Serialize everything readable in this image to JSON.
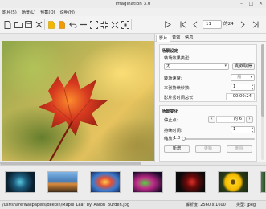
{
  "window": {
    "title": "Imagination 3.0"
  },
  "menubar": {
    "items": [
      "影片(S)",
      "场景(L)",
      "预截(O)",
      "说明(H)"
    ]
  },
  "toolbar": {
    "page_current": "11",
    "page_total": "的24",
    "icons": [
      "new-file-icon",
      "open-folder-icon",
      "save-icon",
      "close-file-icon",
      "import-images-icon",
      "import-audio-icon",
      "undo-icon",
      "remove-icon",
      "zoom-fit-icon",
      "zoom-in-icon",
      "zoom-out-icon",
      "zoom-actual-icon",
      "play-icon",
      "first-slide-icon",
      "prev-slide-icon",
      "next-slide-icon",
      "last-slide-icon"
    ]
  },
  "side_panel": {
    "tabs": [
      "影片",
      "音效",
      "信息"
    ],
    "scene_settings": {
      "header": "场景设定",
      "transition_type_label": "转场效果类型:",
      "transition_type_value": "无",
      "random_button": "乱数取得",
      "transition_speed_label": "转场速度:",
      "transition_speed_value": "一般",
      "duration_label": "本张持续秒数:",
      "duration_value": "1",
      "total_time_label": "影片秀时间总长:",
      "total_time_value": "00:00:24"
    },
    "scene_motion": {
      "header": "场景变化",
      "stop_point_label": "停止点:",
      "stop_point_value": "的 6",
      "duration_label": "持续时间:",
      "duration_value": "1",
      "zoom_label": "缩放:",
      "zoom_value": "1.0",
      "add_button": "新增",
      "update_button": "更新",
      "delete_button": "删除"
    }
  },
  "statusbar": {
    "path": "/usr/share/wallpapers/deepin/Maple_Leaf_by_Aaron_Burden.jpg",
    "resolution": "解析度: 2560 x 1600",
    "type": "类型: jpeg"
  },
  "colors": {
    "accent": "#e68a00",
    "folder": "#d9a600"
  }
}
